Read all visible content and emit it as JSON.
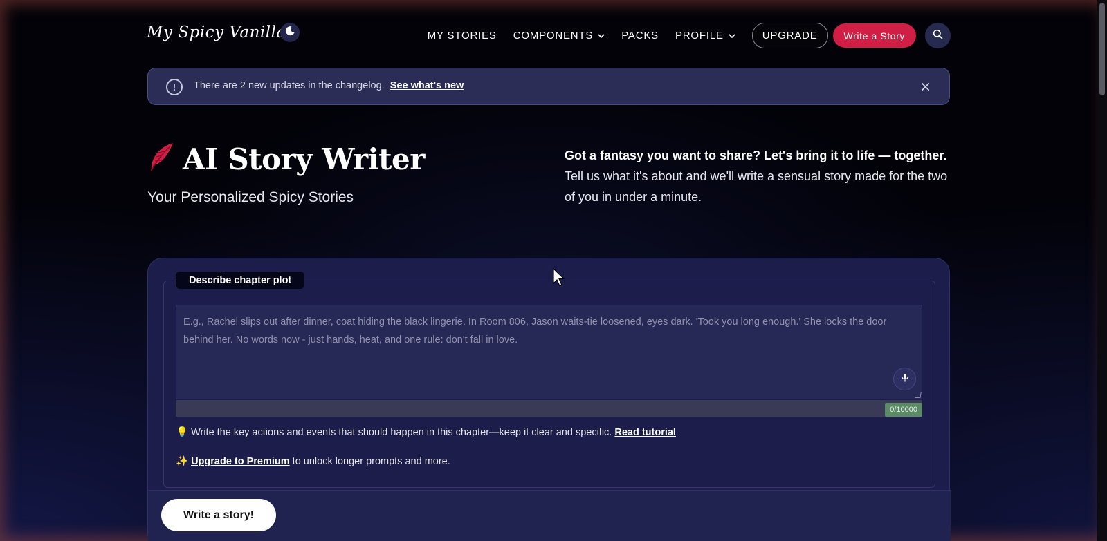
{
  "header": {
    "logo": "My Spicy Vanilla",
    "nav": {
      "my_stories": "MY STORIES",
      "components": "COMPONENTS",
      "packs": "PACKS",
      "profile": "PROFILE",
      "upgrade": "UPGRADE",
      "write_story": "Write a Story"
    },
    "icons": {
      "theme_toggle": "moon-icon",
      "search": "search-icon"
    }
  },
  "banner": {
    "message": "There are 2 new updates in the changelog.",
    "link": "See what's new",
    "close": "×"
  },
  "hero": {
    "title": "AI Story Writer",
    "subtitle": "Your Personalized Spicy Stories",
    "tagline_bold": "Got a fantasy you want to share? Let's bring it to life — together.",
    "tagline": "Tell us what it's about and we'll write a sensual story made for the two of you in under a minute."
  },
  "form": {
    "legend": "Describe chapter plot",
    "placeholder": "E.g., Rachel slips out after dinner, coat hiding the black lingerie. In Room 806, Jason waits-tie loosened, eyes dark. 'Took you long enough.' She locks the door behind her. No words now - just hands, heat, and one rule: don't fall in love.",
    "value": "",
    "counter": "0/10000",
    "hint1_icon": "💡",
    "hint1_text": "Write the key actions and events that should happen in this chapter—keep it clear and specific.",
    "hint1_link": "Read tutorial",
    "hint2_icon": "✨",
    "hint2_link": "Upgrade to Premium",
    "hint2_text": "to unlock longer prompts and more.",
    "submit": "Write a story!"
  },
  "colors": {
    "accent": "#d01e45",
    "card": "#1c1d4a",
    "banner": "#2b2d57",
    "counter": "#5c8a66"
  }
}
